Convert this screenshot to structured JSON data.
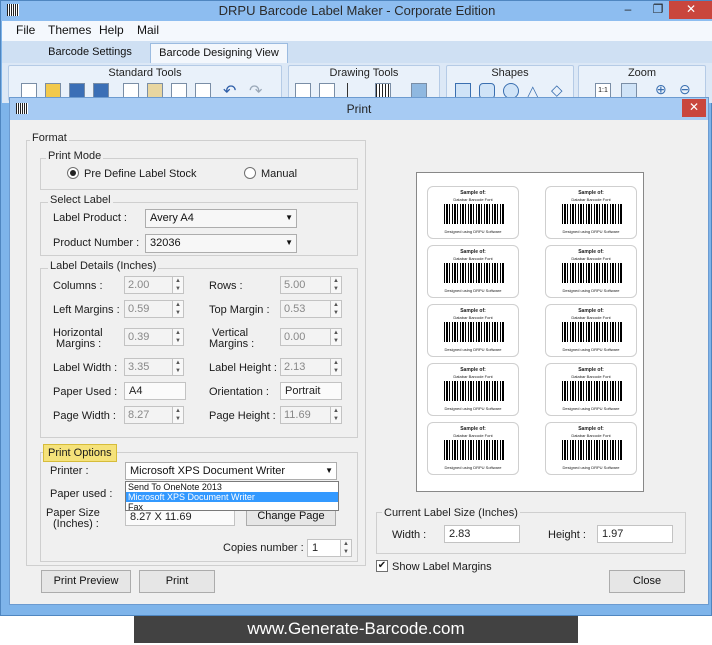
{
  "app": {
    "title": "DRPU Barcode Label Maker - Corporate Edition",
    "menu": [
      "File",
      "Themes",
      "Help",
      "Mail"
    ],
    "tabs": [
      "Barcode Settings",
      "Barcode Designing View"
    ],
    "ribbon_groups": [
      "Standard Tools",
      "Drawing Tools",
      "Shapes",
      "Zoom"
    ]
  },
  "dialog": {
    "title": "Print",
    "close_glyph": "✕",
    "format_label": "Format",
    "print_mode": {
      "label": "Print Mode",
      "option_predefine": "Pre Define Label Stock",
      "option_manual": "Manual"
    },
    "select_label": {
      "label": "Select Label",
      "product_label": "Label Product :",
      "product_value": "Avery A4",
      "number_label": "Product Number :",
      "number_value": "32036"
    },
    "details": {
      "label": "Label Details (Inches)",
      "columns_label": "Columns :",
      "columns_value": "2.00",
      "rows_label": "Rows :",
      "rows_value": "5.00",
      "left_margin_label": "Left Margins :",
      "left_margin_value": "0.59",
      "top_margin_label": "Top Margin :",
      "top_margin_value": "0.53",
      "hmargin_label1": "Horizontal",
      "hmargin_label2": "Margins :",
      "hmargin_value": "0.39",
      "vmargin_label1": "Vertical",
      "vmargin_label2": "Margins :",
      "vmargin_value": "0.00",
      "label_width_label": "Label Width :",
      "label_width_value": "3.35",
      "label_height_label": "Label Height :",
      "label_height_value": "2.13",
      "paper_used_label": "Paper Used :",
      "paper_used_value": "A4",
      "orientation_label": "Orientation :",
      "orientation_value": "Portrait",
      "page_width_label": "Page Width :",
      "page_width_value": "8.27",
      "page_height_label": "Page Height :",
      "page_height_value": "11.69"
    },
    "print_options": {
      "label": "Print Options",
      "printer_label": "Printer :",
      "printer_value": "Microsoft XPS Document Writer",
      "printer_options": [
        "Send To OneNote 2013",
        "Microsoft XPS Document Writer",
        "Fax"
      ],
      "paper_used_label": "Paper used :",
      "paper_size_label1": "Paper Size",
      "paper_size_label2": "(Inches) :",
      "paper_size_value": "8.27 X 11.69",
      "change_page_button": "Change Page",
      "copies_label": "Copies number :",
      "copies_value": "1"
    },
    "preview_card": {
      "line1": "Sample of:",
      "line2": "Databar Barcode Font",
      "line3": "Designed using DRPU Software"
    },
    "current_size": {
      "label": "Current Label Size (Inches)",
      "width_label": "Width :",
      "width_value": "2.83",
      "height_label": "Height :",
      "height_value": "1.97"
    },
    "show_margins_label": "Show Label Margins",
    "show_margins_check": "✔",
    "buttons": {
      "preview": "Print Preview",
      "print": "Print",
      "close": "Close"
    }
  },
  "footer": {
    "text": "www.Generate-Barcode.com"
  }
}
